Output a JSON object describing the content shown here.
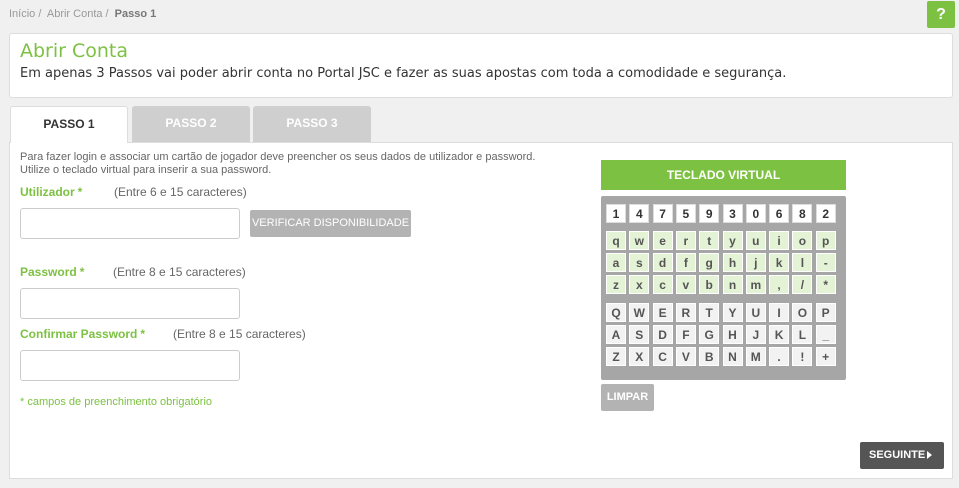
{
  "breadcrumb": {
    "home": "Início /",
    "open_account": "Abrir Conta /",
    "current": "Passo 1"
  },
  "help": {
    "label": "?"
  },
  "intro": {
    "title": "Abrir Conta",
    "text": "Em apenas 3 Passos vai poder abrir conta no Portal JSC e fazer as suas apostas com toda a comodidade e segurança."
  },
  "tabs": [
    {
      "label": "PASSO 1",
      "active": true
    },
    {
      "label": "PASSO 2",
      "active": false
    },
    {
      "label": "PASSO 3",
      "active": false
    }
  ],
  "form": {
    "info_line1": "Para fazer login e associar um cartão de jogador deve preencher os seus dados de utilizador e password.",
    "info_line2": "Utilize o teclado virtual para inserir a sua password.",
    "username_label": "Utilizador",
    "username_hint": "(Entre 6 e 15 caracteres)",
    "username_value": "",
    "verify_label": "VERIFICAR DISPONIBILIDADE",
    "password_label": "Password",
    "password_hint": "(Entre 8 e 15 caracteres)",
    "password_value": "",
    "confirm_label": "Confirmar Password",
    "confirm_hint": "(Entre 8 e 15 caracteres)",
    "confirm_value": "",
    "required_star": "*",
    "required_note": "* campos de preenchimento obrigatório"
  },
  "keyboard": {
    "title": "TECLADO VIRTUAL",
    "numbers": [
      "1",
      "4",
      "7",
      "5",
      "9",
      "3",
      "0",
      "6",
      "8",
      "2"
    ],
    "lower_rows": [
      [
        "q",
        "w",
        "e",
        "r",
        "t",
        "y",
        "u",
        "i",
        "o",
        "p"
      ],
      [
        "a",
        "s",
        "d",
        "f",
        "g",
        "h",
        "j",
        "k",
        "l",
        "-"
      ],
      [
        "z",
        "x",
        "c",
        "v",
        "b",
        "n",
        "m",
        ",",
        "/",
        "*"
      ]
    ],
    "upper_rows": [
      [
        "Q",
        "W",
        "E",
        "R",
        "T",
        "Y",
        "U",
        "I",
        "O",
        "P"
      ],
      [
        "A",
        "S",
        "D",
        "F",
        "G",
        "H",
        "J",
        "K",
        "L",
        "_"
      ],
      [
        "Z",
        "X",
        "C",
        "V",
        "B",
        "N",
        "M",
        ".",
        "!",
        "+"
      ]
    ],
    "clear_label": "LIMPAR"
  },
  "next_label": "SEGUINTE",
  "colors": {
    "accent": "#7dc142",
    "button_gray": "#b3b3b3",
    "dark_button": "#555555"
  }
}
